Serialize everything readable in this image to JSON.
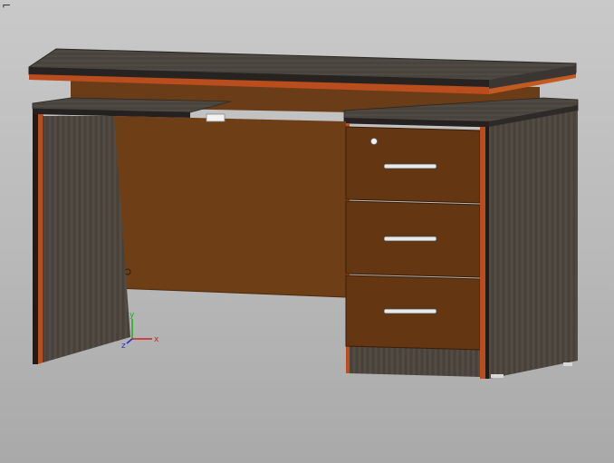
{
  "viewport": {
    "name": "cad-3d-viewport",
    "corner_glyph": "⌐"
  },
  "model": {
    "name": "office-desk",
    "colors": {
      "background_top": "#c9c9c9",
      "background_bottom": "#a9a9a9",
      "dark_wood": "#4a433c",
      "dark_wood_light": "#5a534b",
      "orange_edge": "#b94d1d",
      "panel_brown": "#6e3e16",
      "drawer_brown": "#653612",
      "black_edge": "#1e1e1e",
      "handle_silver": "#e8e8e8"
    },
    "drawer_count": 3
  },
  "triad": {
    "x_label": "x",
    "y_label": "y",
    "z_label": "z",
    "x_color": "#d42020",
    "y_color": "#18b018",
    "z_color": "#2030d0"
  }
}
